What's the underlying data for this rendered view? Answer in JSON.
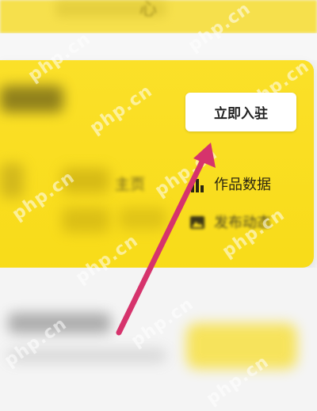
{
  "header": {
    "blurred_char": "心"
  },
  "card": {
    "join_button": "立即入驻",
    "left_label_blurred": "主页",
    "menu": [
      {
        "label": "作品数据",
        "icon": "bar-chart-icon"
      },
      {
        "label": "发布动态",
        "icon": "image-icon"
      }
    ]
  },
  "watermark": {
    "text": "php.cn"
  },
  "colors": {
    "accent_yellow": "#f8dc1c",
    "arrow_pink": "#d6336c"
  }
}
